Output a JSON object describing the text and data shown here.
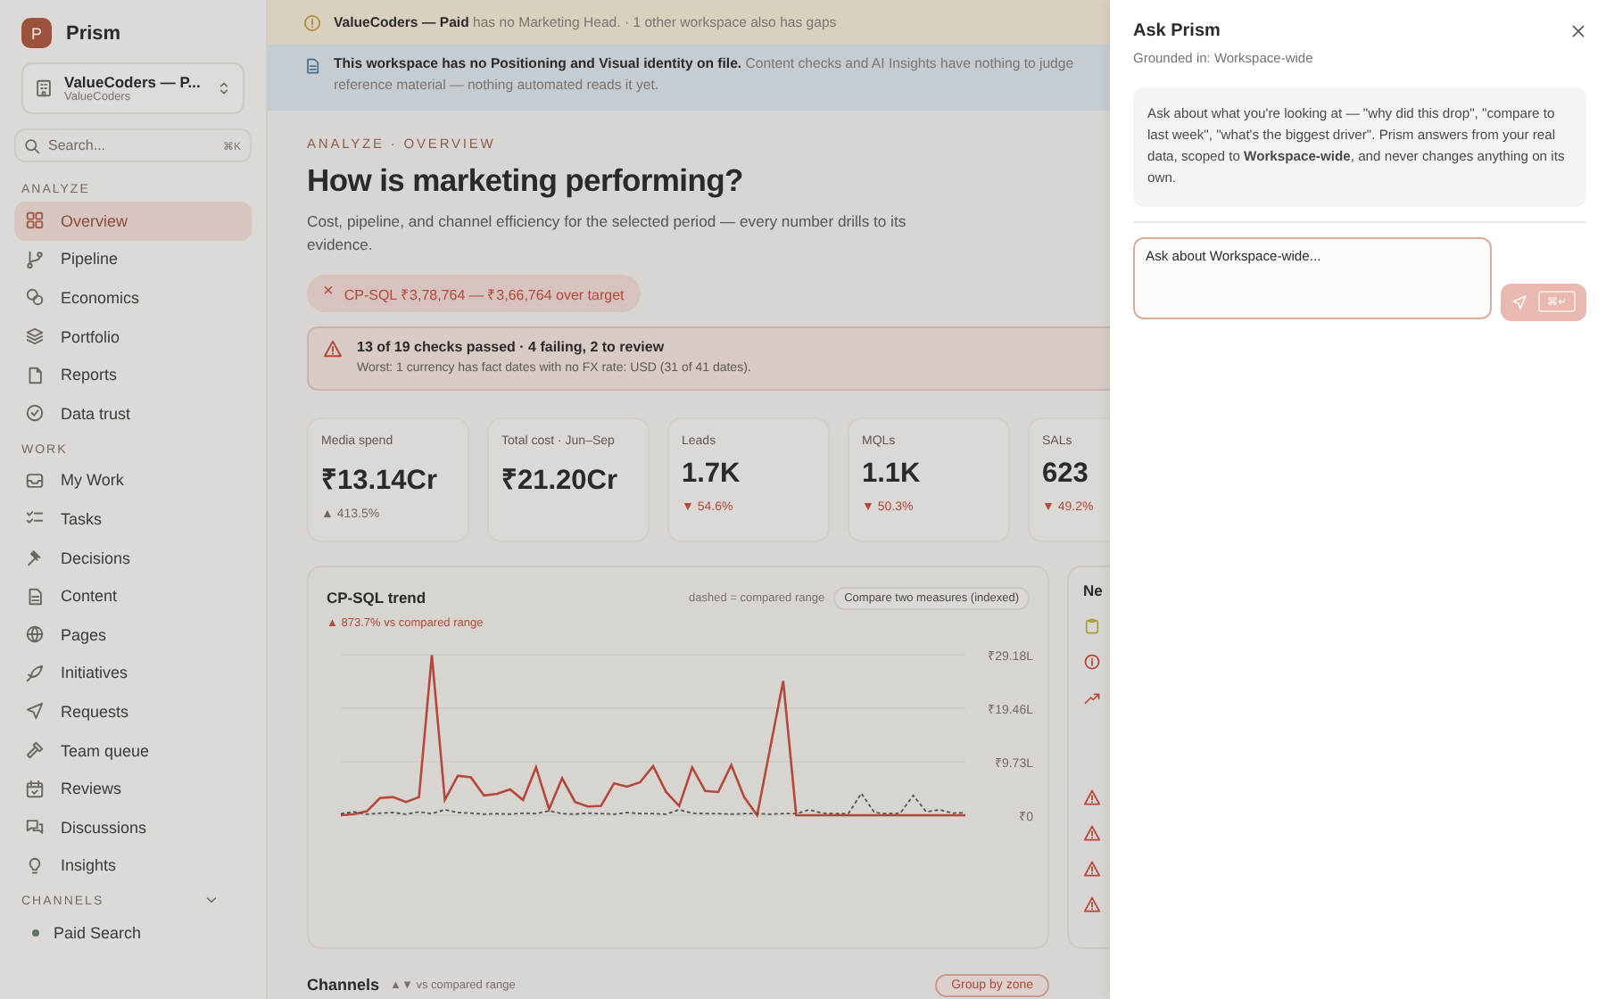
{
  "app": {
    "logo_letter": "P",
    "name": "Prism"
  },
  "workspace": {
    "name": "ValueCoders — P...",
    "subtitle": "ValueCoders"
  },
  "search": {
    "placeholder": "Search...",
    "shortcut": "⌘K"
  },
  "sidebar": {
    "sections": [
      {
        "title": "ANALYZE",
        "items": [
          {
            "label": "Overview",
            "selected": true
          },
          {
            "label": "Pipeline",
            "selected": false
          },
          {
            "label": "Economics",
            "selected": false
          },
          {
            "label": "Portfolio",
            "selected": false
          },
          {
            "label": "Reports",
            "selected": false
          },
          {
            "label": "Data trust",
            "selected": false
          }
        ]
      },
      {
        "title": "WORK",
        "items": [
          {
            "label": "My Work",
            "selected": false
          },
          {
            "label": "Tasks",
            "selected": false
          },
          {
            "label": "Decisions",
            "selected": false
          },
          {
            "label": "Content",
            "selected": false
          },
          {
            "label": "Pages",
            "selected": false
          },
          {
            "label": "Initiatives",
            "selected": false
          },
          {
            "label": "Requests",
            "selected": false
          },
          {
            "label": "Team queue",
            "selected": false
          },
          {
            "label": "Reviews",
            "selected": false
          },
          {
            "label": "Discussions",
            "selected": false
          },
          {
            "label": "Insights",
            "selected": false
          }
        ]
      }
    ],
    "channels": {
      "title": "CHANNELS",
      "expanded": true,
      "items": [
        {
          "label": "Paid Search",
          "color": "#5f7566"
        }
      ]
    }
  },
  "banners": [
    {
      "kind": "warning",
      "lines": [
        "**ValueCoders — Paid** has no Marketing Head. · 1 other workspace also has gaps"
      ]
    },
    {
      "kind": "info",
      "lines": [
        "**This workspace has no Positioning and Visual identity on file.** Content checks and AI Insights have nothing to judge",
        "reference material — nothing automated reads it yet."
      ]
    }
  ],
  "page": {
    "breadcrumb": "ANALYZE · OVERVIEW",
    "title": "How is marketing performing?",
    "subtitle": "Cost, pipeline, and channel efficiency for the selected period — every number drills to its evidence.",
    "alert_pill": {
      "icon": "×",
      "text": "CP-SQL ₹3,78,764 — ₹3,66,764 over target"
    },
    "checks": {
      "title": "13 of 19 checks passed · 4 failing, 2 to review",
      "detail": "Worst: 1 currency has fact dates with no FX rate: USD (31 of 41 dates)."
    }
  },
  "kpis": [
    {
      "label": "Media spend",
      "value": "₹13.14Cr",
      "change": "▲ 413.5%",
      "color": "#6f6a66"
    },
    {
      "label": "Total cost · Jun–Sep",
      "value": "₹21.20Cr"
    },
    {
      "label": "Leads",
      "value": "1.7K",
      "change": "▼ 54.6%",
      "color": "#b5483a"
    },
    {
      "label": "MQLs",
      "value": "1.1K",
      "change": "▼ 50.3%",
      "color": "#b5483a"
    },
    {
      "label": "SALs",
      "value": "623",
      "change": "▼ 49.2%",
      "color": "#b5483a"
    }
  ],
  "trend_card": {
    "title": "CP-SQL trend",
    "legend": "dashed = compared range",
    "compare_button": "Compare two measures (indexed)",
    "delta": "▲ 873.7% vs compared range",
    "chart_data": {
      "type": "line",
      "ylim": [
        0,
        29.18
      ],
      "yticks": [
        {
          "value": 0,
          "label": "₹0"
        },
        {
          "value": 9.73,
          "label": "₹9.73L"
        },
        {
          "value": 19.46,
          "label": "₹19.46L"
        },
        {
          "value": 29.18,
          "label": "₹29.18L"
        }
      ],
      "series": [
        {
          "color": "#b5483a",
          "line_style": "solid",
          "values": [
            0,
            0.2,
            0.7,
            3.1,
            3.3,
            2.4,
            3.3,
            29.1,
            2.8,
            7.2,
            6.9,
            3.6,
            3.9,
            4.7,
            2.8,
            8.7,
            1.1,
            6.7,
            2.4,
            1.6,
            1.7,
            5.8,
            5.2,
            6.0,
            8.9,
            4.2,
            1.7,
            8.7,
            4.4,
            4.2,
            9.1,
            3.3,
            0,
            12.2,
            24.4,
            0,
            0,
            0,
            0,
            0,
            0,
            0,
            0,
            0,
            0,
            0,
            0,
            0,
            0
          ]
        },
        {
          "color": "#555555",
          "line_style": "dashed",
          "values": [
            0.3,
            0.6,
            0.2,
            0.4,
            0.5,
            0.2,
            0.6,
            0.3,
            1.0,
            0.5,
            0.4,
            0.2,
            0.3,
            0.2,
            0.4,
            0.3,
            0.8,
            0.3,
            0.2,
            0.4,
            0.3,
            0.2,
            0.5,
            0.3,
            0.3,
            0.2,
            1.0,
            0.4,
            0.3,
            0.3,
            0.2,
            0.3,
            0.3,
            0.2,
            0.3,
            0.3,
            1.0,
            0.4,
            0.3,
            0.3,
            4.0,
            0.5,
            0.3,
            0.4,
            3.6,
            0.6,
            1.0,
            0.4,
            0.5
          ]
        }
      ]
    }
  },
  "side_panel": {
    "title": "Ne"
  },
  "channels_section": {
    "title": "Channels",
    "legend": "▲▼ vs compared range",
    "button": "Group by zone"
  },
  "drawer": {
    "title": "Ask Prism",
    "grounded": "Grounded in: Workspace-wide",
    "intro": "Ask about what you're looking at — \"why did this drop\", \"compare to last week\", \"what's the biggest driver\". Prism answers from your real data, scoped to **Workspace-wide**, and never changes anything on its own.",
    "input_placeholder": "Ask about Workspace-wide...",
    "send_shortcut": "⌘↵",
    "send_disabled": true
  }
}
